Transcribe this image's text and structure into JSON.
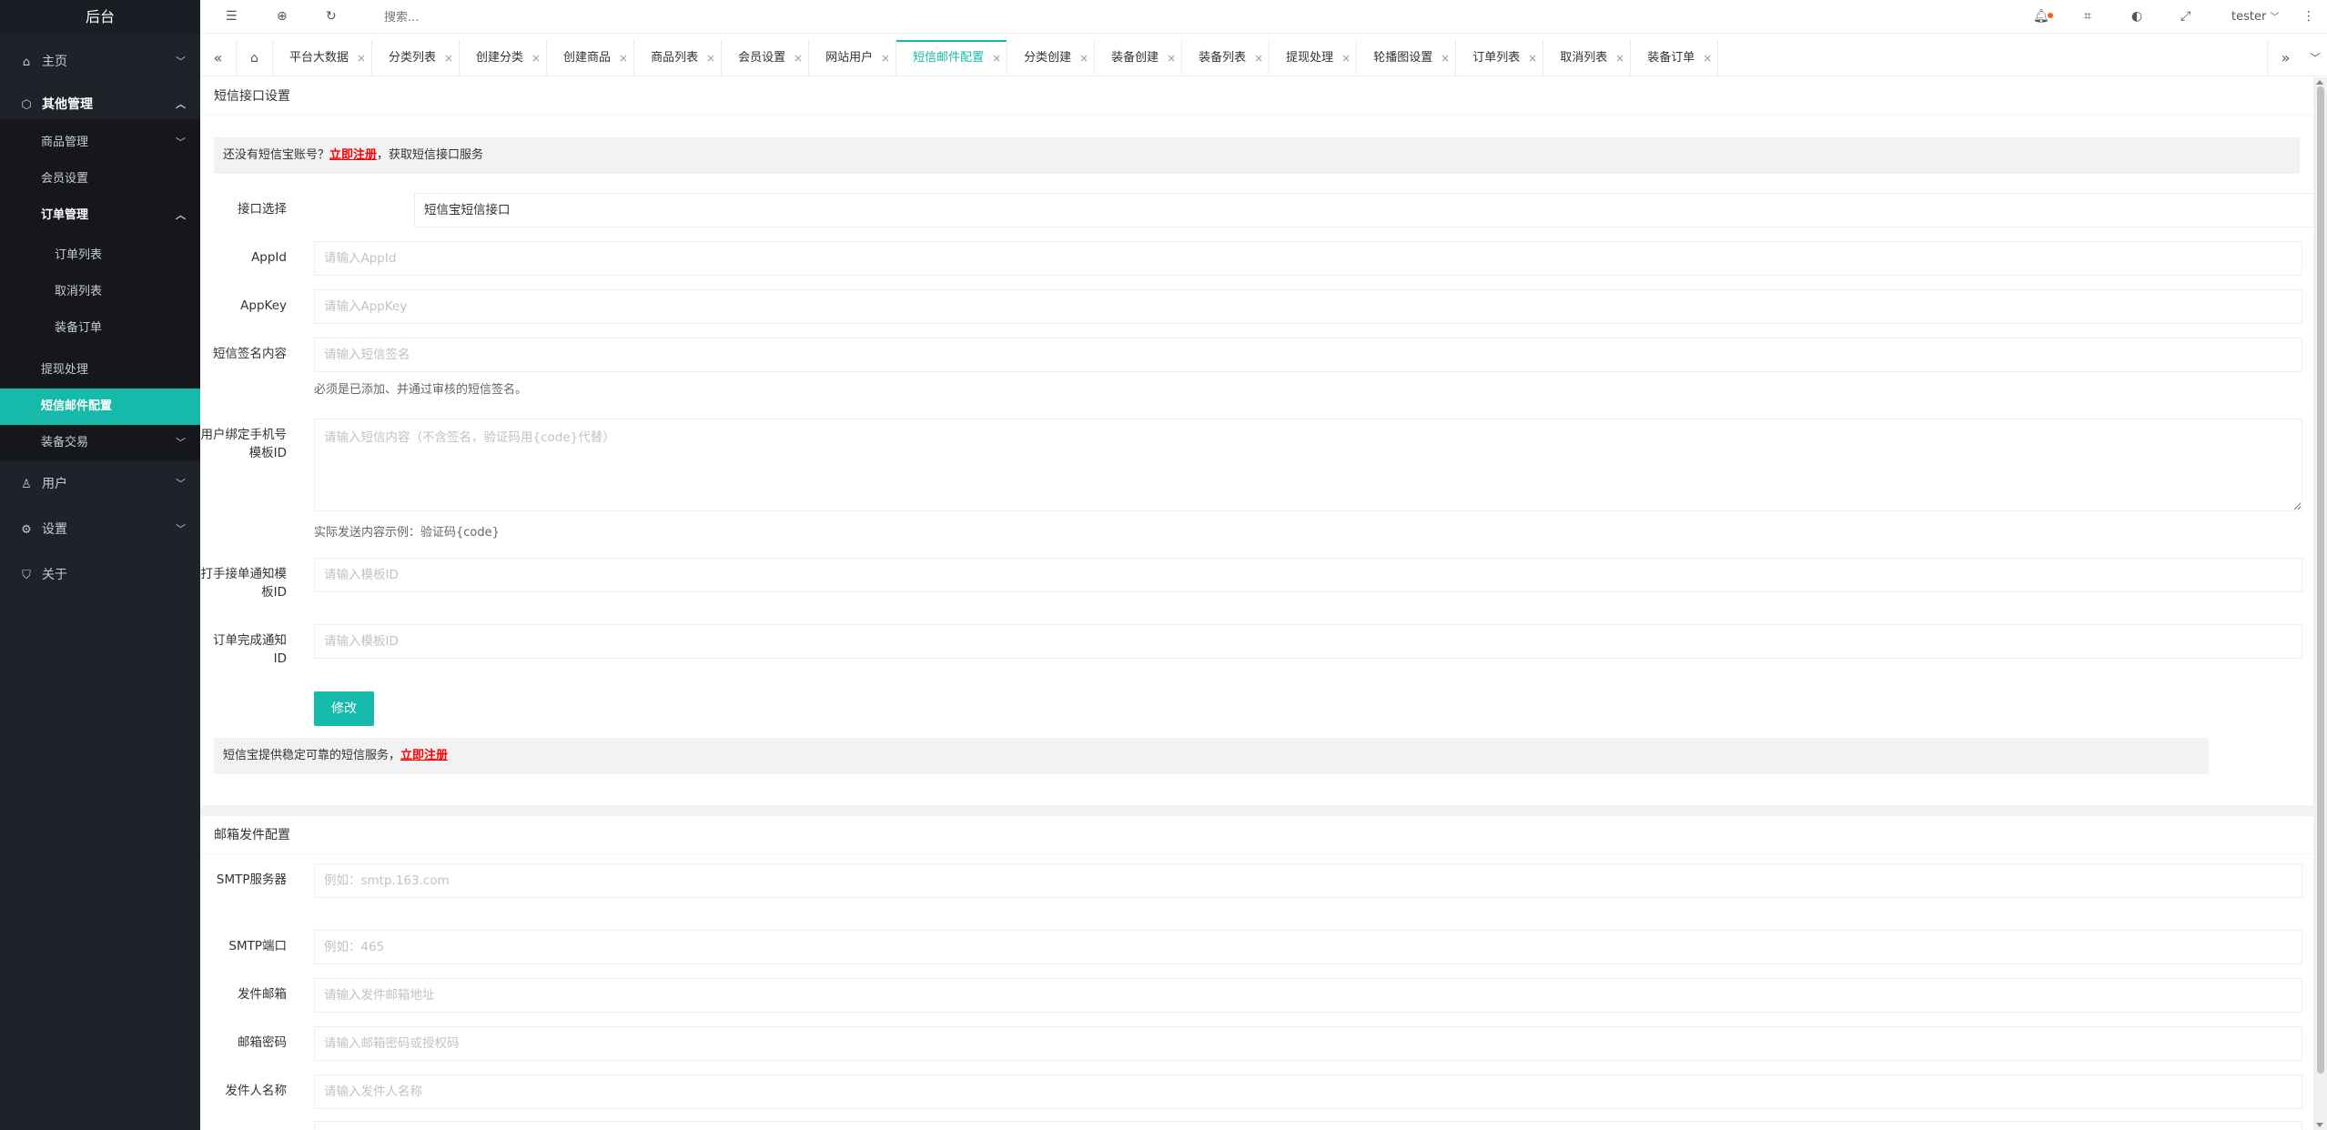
{
  "app": {
    "title": "后台",
    "user": "tester"
  },
  "topbar": {
    "search_placeholder": "搜索..."
  },
  "sidebar": {
    "home": "主页",
    "other": "其他管理",
    "goods": "商品管理",
    "member": "会员设置",
    "orders": "订单管理",
    "order_list": "订单列表",
    "cancel_list": "取消列表",
    "equip_order": "装备订单",
    "withdraw": "提现处理",
    "sms_mail": "短信邮件配置",
    "equip_trade": "装备交易",
    "users": "用户",
    "settings": "设置",
    "about": "关于"
  },
  "tabs": [
    {
      "label": "平台大数据",
      "active": false
    },
    {
      "label": "分类列表",
      "active": false
    },
    {
      "label": "创建分类",
      "active": false
    },
    {
      "label": "创建商品",
      "active": false
    },
    {
      "label": "商品列表",
      "active": false
    },
    {
      "label": "会员设置",
      "active": false
    },
    {
      "label": "网站用户",
      "active": false
    },
    {
      "label": "短信邮件配置",
      "active": true
    },
    {
      "label": "分类创建",
      "active": false
    },
    {
      "label": "装备创建",
      "active": false
    },
    {
      "label": "装备列表",
      "active": false
    },
    {
      "label": "提现处理",
      "active": false
    },
    {
      "label": "轮播图设置",
      "active": false
    },
    {
      "label": "订单列表",
      "active": false
    },
    {
      "label": "取消列表",
      "active": false
    },
    {
      "label": "装备订单",
      "active": false
    }
  ],
  "sms": {
    "title": "短信接口设置",
    "notice_prefix": "还没有短信宝账号？",
    "notice_link": "立即注册",
    "notice_suffix": "，获取短信接口服务",
    "interface_label": "接口选择",
    "interface_value": "短信宝短信接口",
    "appid_label": "AppId",
    "appid_placeholder": "请输入AppId",
    "appkey_label": "AppKey",
    "appkey_placeholder": "请输入AppKey",
    "sign_label": "短信签名内容",
    "sign_placeholder": "请输入短信签名",
    "sign_help": "必须是已添加、并通过审核的短信签名。",
    "bind_label": "用户绑定手机号模板ID",
    "bind_placeholder": "请输入短信内容（不含签名，验证码用{code}代替）",
    "bind_help": "实际发送内容示例：验证码{code}",
    "accept_label": "打手接单通知模板ID",
    "accept_placeholder": "请输入模板ID",
    "complete_label": "订单完成通知ID",
    "complete_placeholder": "请输入模板ID",
    "submit": "修改",
    "footer_prefix": "短信宝提供稳定可靠的短信服务，",
    "footer_link": "立即注册"
  },
  "mail": {
    "title": "邮箱发件配置",
    "smtp_label": "SMTP服务器",
    "smtp_placeholder": "例如：smtp.163.com",
    "port_label": "SMTP端口",
    "port_placeholder": "例如：465",
    "sender_label": "发件邮箱",
    "sender_placeholder": "请输入发件邮箱地址",
    "password_label": "邮箱密码",
    "password_placeholder": "请输入邮箱密码或授权码",
    "name_label": "发件人名称",
    "name_placeholder": "请输入发件人名称"
  },
  "colors": {
    "accent": "#16baaa",
    "sidebar": "#20222a",
    "link": "#ff0000"
  }
}
